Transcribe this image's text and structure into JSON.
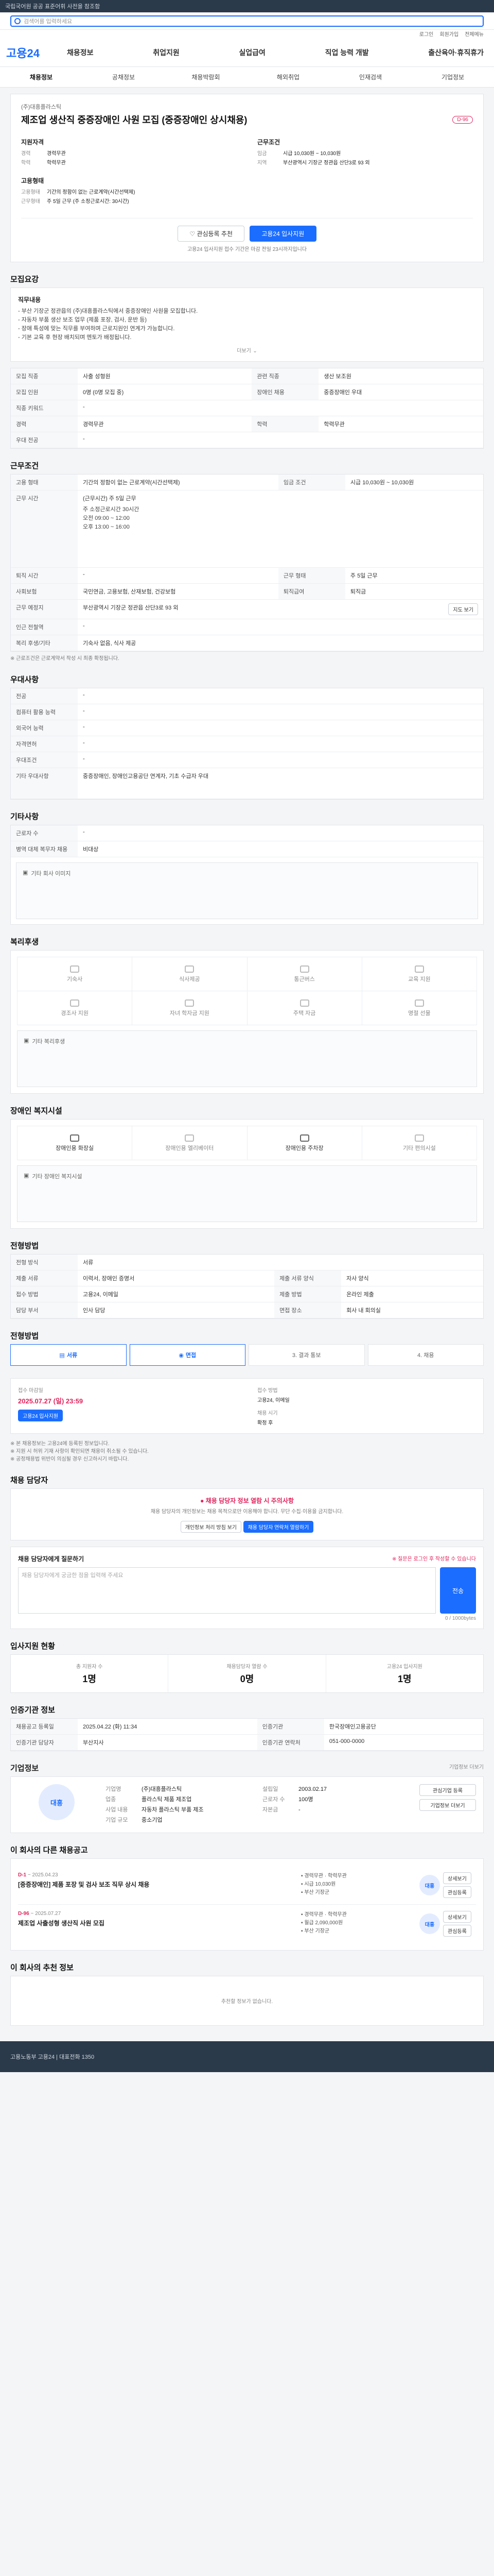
{
  "topbar": {
    "notice": "국립국어원 공공 표준어휘 사전을 참조함"
  },
  "search": {
    "placeholder": "검색어를 입력하세요"
  },
  "util": {
    "login": "로그인",
    "join": "회원가입",
    "menu": "전체메뉴"
  },
  "brand": {
    "name": "고용24"
  },
  "gnb": {
    "items": [
      "채용정보",
      "취업지원",
      "실업급여",
      "직업 능력 개발",
      "출산육아·휴직휴가"
    ]
  },
  "subnav": {
    "items": [
      "채용정보",
      "공채정보",
      "채용박람회",
      "해외취업",
      "인재검색",
      "기업정보"
    ]
  },
  "job": {
    "company": "(주)대흥플라스틱",
    "title": "제조업 생산직 중증장애인 사원 모집 (중증장애인 상시채용)",
    "dday": "D-96",
    "left_heading": "지원자격",
    "left_rows": [
      {
        "k": "경력",
        "v": "경력무관"
      },
      {
        "k": "학력",
        "v": "학력무관"
      }
    ],
    "left_heading2": "고용형태",
    "left_rows2": [
      {
        "k": "고용형태",
        "v": "기간의 정함이 없는 근로계약(시간선택제)"
      },
      {
        "k": "근무형태",
        "v": "주 5일 근무 (주 소정근로시간: 30시간)"
      }
    ],
    "right_heading": "근무조건",
    "right_rows": [
      {
        "k": "임금",
        "v": "시급 10,030원 ~ 10,030원"
      },
      {
        "k": "지역",
        "v": "부산광역시 기장군 정관읍 산단3로 93 외"
      }
    ],
    "scrap": "관심등록 추천",
    "apply": "고용24 입사지원",
    "posted_note": "고용24 입사지원 접수 기간은 마감 전일 23시까지입니다"
  },
  "recruit": {
    "title": "모집요강",
    "desc_head": "직무내용",
    "desc_lines": [
      "- 부산 기장군 정관읍의 (주)대흥플라스틱에서 중증장애인 사원을 모집합니다.",
      "- 자동차 부품 생산 보조 업무 (제품 포장, 검사, 운반 등)",
      "- 장애 특성에 맞는 직무를 부여하며 근로지원인 연계가 가능합니다.",
      "- 기본 교육 후 현장 배치되며 멘토가 배정됩니다."
    ],
    "more": "더보기",
    "rows": [
      {
        "k": "모집 직종",
        "v": "사출 성형원",
        "k2": "관련 직종",
        "v2": "생산 보조원"
      },
      {
        "k": "모집 인원",
        "v": "0명 (0명 모집 중)",
        "k2": "장애인 채용",
        "v2": "중증장애인 우대"
      },
      {
        "k": "직종 키워드",
        "v": "-",
        "k2": "",
        "v2": ""
      },
      {
        "k": "경력",
        "v": "경력무관",
        "k2": "학력",
        "v2": "학력무관"
      },
      {
        "k": "우대 전공",
        "v": "-",
        "k2": "",
        "v2": ""
      }
    ]
  },
  "condition": {
    "title": "근무조건",
    "rows": [
      {
        "k": "고용 형태",
        "v": "기간의 정함이 없는 근로계약(시간선택제)",
        "k2": "임금 조건",
        "v2": "시급 10,030원 ~ 10,030원"
      },
      {
        "k": "근무 시간",
        "v": "(근무시간) 주 5일 근무",
        "k2": "",
        "v2": ""
      },
      {
        "k": "퇴직 시간",
        "v": "-",
        "k2": "근무 형태",
        "v2": "주 5일 근무"
      },
      {
        "k": "사회보험",
        "v": "국민연금, 고용보험, 산재보험, 건강보험",
        "k2": "퇴직급여",
        "v2": "퇴직금"
      },
      {
        "k": "근무 예정지",
        "v": "부산광역시 기장군 정관읍 산단3로 93 외",
        "k2": "",
        "v2": ""
      },
      {
        "k": "인근 전철역",
        "v": "-",
        "k2": "",
        "v2": ""
      },
      {
        "k": "복리 후생/기타",
        "v": "기숙사 없음, 식사 제공",
        "k2": "",
        "v2": ""
      }
    ],
    "hours": [
      "주 소정근로시간 30시간",
      "오전 09:00 ~ 12:00",
      "오후 13:00 ~ 16:00"
    ],
    "map_btn": "지도 보기",
    "note": "※ 근로조건은 근로계약서 작성 시 최종 확정됩니다."
  },
  "apply_info": {
    "title": "우대사항",
    "rows": [
      {
        "k": "전공",
        "v": "-"
      },
      {
        "k": "컴퓨터 활용 능력",
        "v": "-"
      },
      {
        "k": "외국어 능력",
        "v": "-"
      },
      {
        "k": "자격면허",
        "v": "-"
      },
      {
        "k": "우대조건",
        "v": "-"
      },
      {
        "k": "기타 우대사항",
        "v": "중증장애인, 장애인고용공단 연계자, 기초 수급자 우대"
      }
    ]
  },
  "extra": {
    "title": "기타사항",
    "rows": [
      {
        "k": "근로자 수",
        "v": "-"
      },
      {
        "k": "병역 대체 복무자 채용",
        "v": "비대상"
      }
    ],
    "img_label": "기타 회사 이미지"
  },
  "welfare": {
    "title": "복리후생",
    "items": [
      "기숙사",
      "식사제공",
      "통근버스",
      "교육 지원",
      "경조사 지원",
      "자녀 학자금 지원",
      "주택 자금",
      "명절 선물"
    ],
    "img_label": "기타 복리후생"
  },
  "facility": {
    "title": "장애인 복지시설",
    "items": [
      "장애인용 화장실",
      "장애인용 엘리베이터",
      "장애인용 주차장",
      "기타 편의시설"
    ],
    "img_label": "기타 장애인 복지시설"
  },
  "selection": {
    "title": "전형방법",
    "rows": [
      {
        "k": "전형 방식",
        "v": "서류",
        "k2": "",
        "v2": ""
      },
      {
        "k": "제출 서류",
        "v": "이력서, 장애인 증명서",
        "k2": "제출 서류 양식",
        "v2": "자사 양식"
      },
      {
        "k": "접수 방법",
        "v": "고용24, 이메일",
        "k2": "제출 방법",
        "v2": "온라인 제출"
      },
      {
        "k": "담당 부서",
        "v": "인사 담당",
        "k2": "면접 장소",
        "v2": "회사 내 회의실"
      }
    ]
  },
  "process": {
    "title": "전형방법",
    "steps": [
      "서류",
      "면접",
      "3. 결과 통보",
      "4. 채용"
    ]
  },
  "schedule": {
    "start_label": "접수 마감일",
    "start": "2025.07.27 (일) 23:59",
    "apply_btn": "고용24 입사지원",
    "method_label": "접수 방법",
    "method": "고용24, 이메일",
    "result_label": "채용 시기",
    "result": "확정 후",
    "notes": [
      "※ 본 채용정보는 고용24에 등록된 정보입니다.",
      "※ 지원 시 허위 기재 사항이 확인되면 채용이 취소될 수 있습니다.",
      "※ 공정채용법 위반이 의심될 경우 신고하시기 바랍니다."
    ]
  },
  "contact": {
    "title": "채용 담당자",
    "alert": "채용 담당자 정보 열람 시 주의사항",
    "alert_text": "채용 담당자의 개인정보는 채용 목적으로만 이용해야 합니다. 무단 수집·이용을 금지합니다.",
    "btn1": "개인정보 처리 방침 보기",
    "btn2": "채용 담당자 연락처 열람하기",
    "question_title": "채용 담당자에게 질문하기",
    "question_note": "※ 질문은 로그인 후 작성할 수 있습니다",
    "question_placeholder": "채용 담당자에게 궁금한 점을 입력해 주세요",
    "send": "전송",
    "counter": "0 / 1000bytes"
  },
  "stats": {
    "title": "입사지원 현황",
    "items": [
      {
        "k": "총 지원자 수",
        "v": "1명"
      },
      {
        "k": "채용담당자 열람 수",
        "v": "0명"
      },
      {
        "k": "고용24 입사지원",
        "v": "1명"
      }
    ]
  },
  "notice": {
    "title": "인증기관 정보",
    "rows": [
      {
        "k": "채용공고 등록일",
        "v": "2025.04.22 (화) 11:34",
        "k2": "인증기관",
        "v2": "한국장애인고용공단"
      },
      {
        "k": "인증기관 담당자",
        "v": "부산지사",
        "k2": "인증기관 연락처",
        "v2": "051-000-0000"
      }
    ]
  },
  "company": {
    "title": "기업정보",
    "more": "기업정보 더보기",
    "logo": "대흥",
    "rows": [
      {
        "k": "기업명",
        "v": "(주)대흥플라스틱"
      },
      {
        "k": "업종",
        "v": "플라스틱 제품 제조업"
      },
      {
        "k": "사업 내용",
        "v": "자동차 플라스틱 부품 제조"
      },
      {
        "k": "기업 규모",
        "v": "중소기업"
      }
    ],
    "rows2": [
      {
        "k": "설립일",
        "v": "2003.02.17"
      },
      {
        "k": "근로자 수",
        "v": "100명"
      },
      {
        "k": "자본금",
        "v": "-"
      }
    ],
    "btn_a": "관심기업 등록",
    "btn_b": "기업정보 더보기"
  },
  "other": {
    "title": "이 회사의 다른 채용공고",
    "items": [
      {
        "dday": "D-1",
        "date": "~ 2025.04.23",
        "title": "[중증장애인] 제품 포장 및 검사 보조 직무 상시 채용",
        "tag1": "경력무관",
        "tag2": "학력무관",
        "wage": "시급 10,030원",
        "place": "부산 기장군"
      },
      {
        "dday": "D-96",
        "date": "~ 2025.07.27",
        "title": "제조업 사출성형 생산직 사원 모집",
        "tag1": "경력무관",
        "tag2": "학력무관",
        "wage": "월급 2,090,000원",
        "place": "부산 기장군"
      }
    ],
    "btn_view": "상세보기",
    "btn_scrap": "관심등록"
  },
  "related": {
    "title": "이 회사의 추천 정보",
    "empty": "추천할 정보가 없습니다."
  },
  "footer": {
    "text": "고용노동부 고용24 | 대표전화 1350"
  }
}
